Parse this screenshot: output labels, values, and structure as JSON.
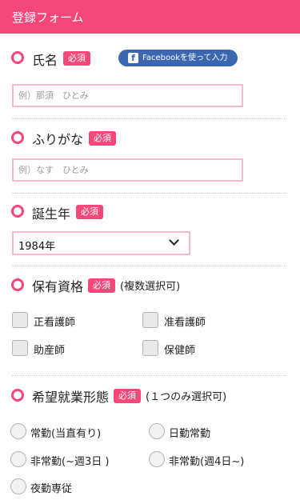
{
  "header": {
    "title": "登録フォーム"
  },
  "facebook": {
    "icon": "f",
    "label": "Facebookを使って入力"
  },
  "questions": {
    "name": {
      "label": "氏名",
      "required": "必須",
      "placeholder": "例）那須　ひとみ"
    },
    "kana": {
      "label": "ふりがな",
      "required": "必須",
      "placeholder": "例）なす　ひとみ"
    },
    "birth_year": {
      "label": "誕生年",
      "required": "必須",
      "selected": "1984年"
    },
    "qualifications": {
      "label": "保有資格",
      "required": "必須",
      "note": "(複数選択可)",
      "options": [
        "正看護師",
        "准看護師",
        "助産師",
        "保健師"
      ]
    },
    "work_style": {
      "label": "希望就業形態",
      "required": "必須",
      "note": "(１つのみ選択可)",
      "options": [
        "常勤(当直有り)",
        "日勤常勤",
        "非常勤(~週3日 )",
        "非常勤(週4日~)",
        "夜勤専従"
      ]
    }
  },
  "colors": {
    "accent": "#f4477a",
    "input_border": "#f6b9cf",
    "facebook": "#3b67b0"
  }
}
